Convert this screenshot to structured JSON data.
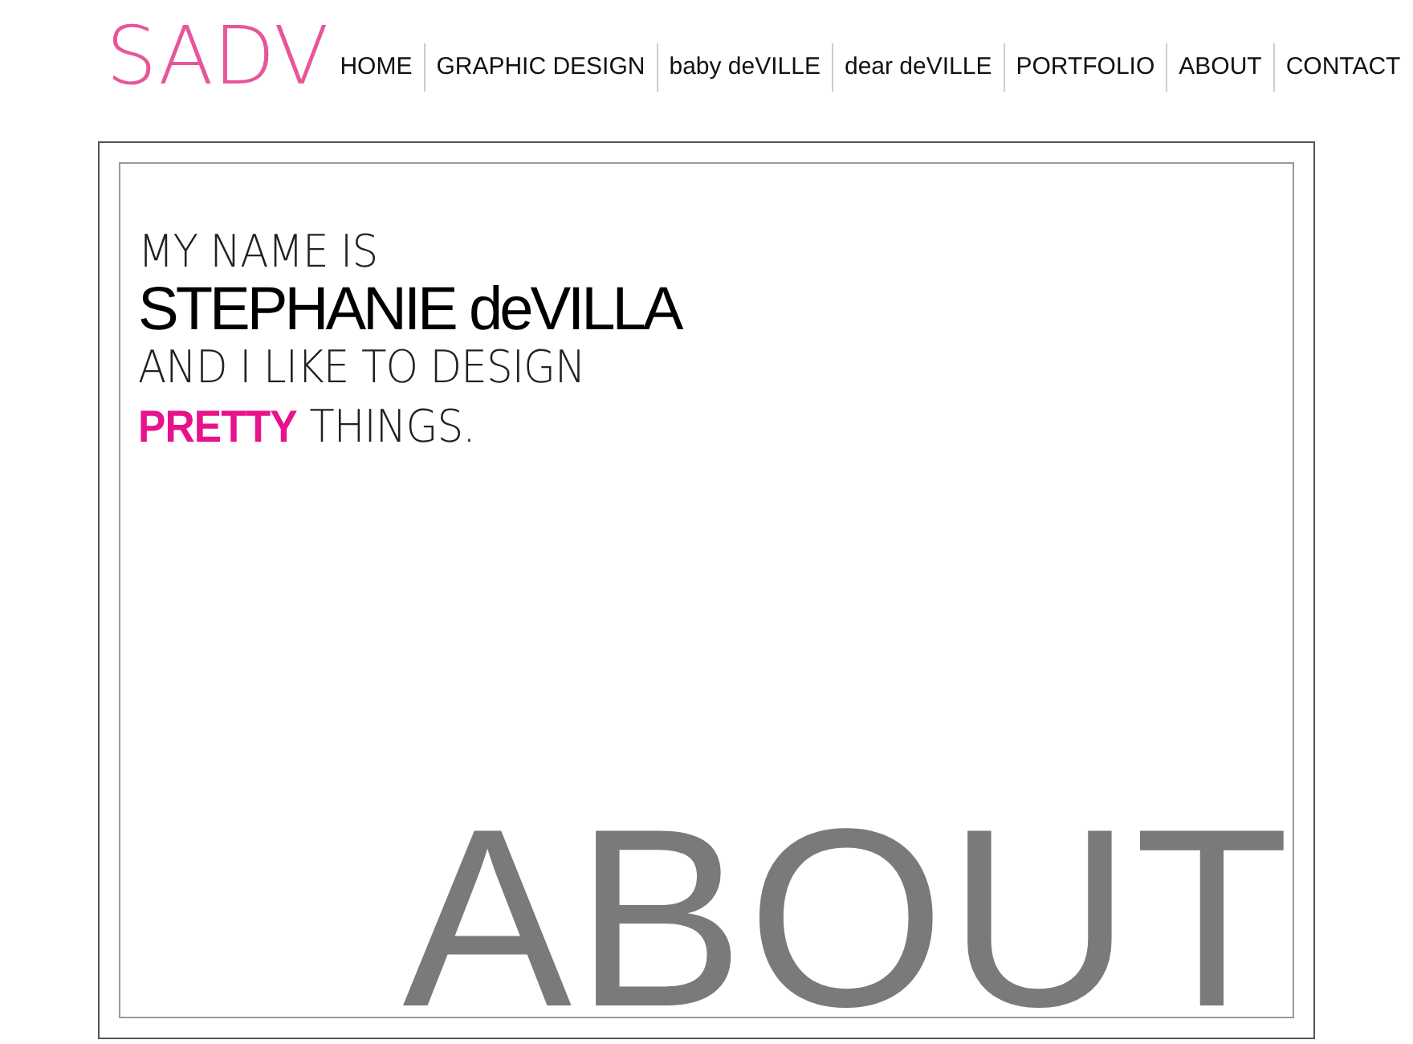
{
  "logo": "SADV",
  "nav": [
    {
      "label": "HOME",
      "selected": false
    },
    {
      "label": "GRAPHIC DESIGN",
      "selected": false
    },
    {
      "label": "baby deVILLE",
      "selected": false
    },
    {
      "label": "dear deVILLE",
      "selected": false
    },
    {
      "label": "PORTFOLIO",
      "selected": false
    },
    {
      "label": "ABOUT",
      "selected": false
    },
    {
      "label": "CONTACT",
      "selected": false
    }
  ],
  "intro": [
    {
      "kind": "light",
      "text": "MY NAME IS"
    },
    {
      "kind": "name",
      "text": "STEPHANIE deVILLA"
    },
    {
      "kind": "light",
      "text": "AND I LIKE TO DESIGN"
    },
    {
      "kind": "light",
      "text": "**PRETTY** THINGS."
    }
  ],
  "page_heading": "ABOUT"
}
